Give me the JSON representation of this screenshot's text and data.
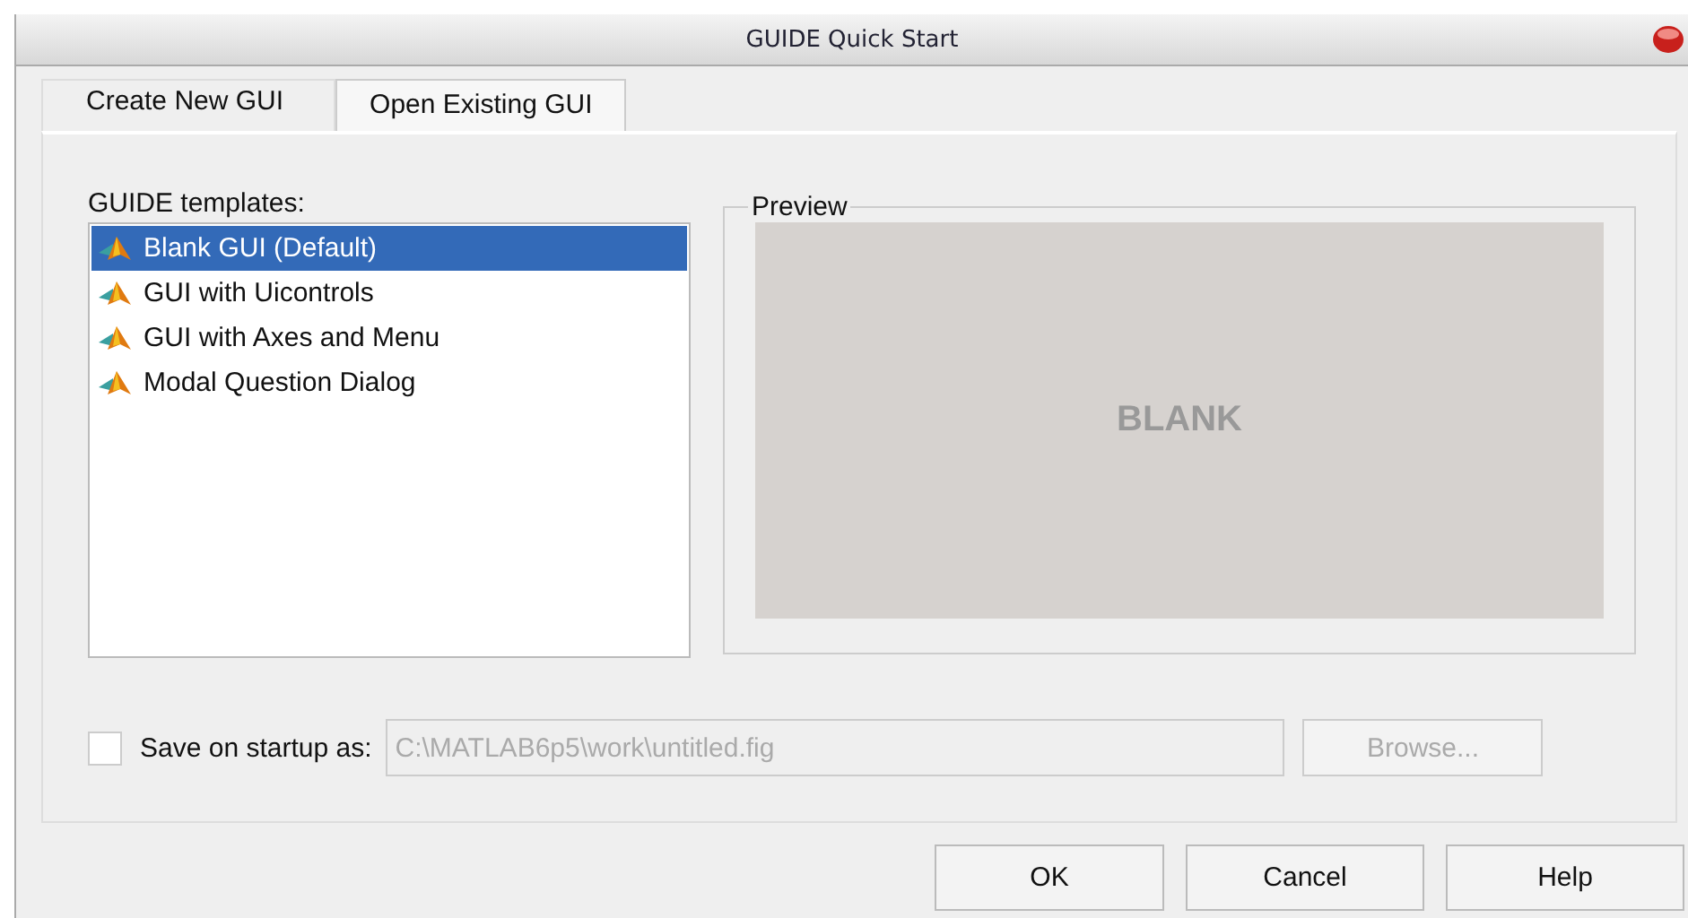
{
  "window": {
    "title": "GUIDE Quick Start"
  },
  "tabs": [
    {
      "label": "Create New GUI",
      "selected": true
    },
    {
      "label": "Open Existing GUI",
      "selected": false
    }
  ],
  "templates": {
    "label": "GUIDE templates:",
    "items": [
      {
        "label": "Blank GUI (Default)",
        "selected": true
      },
      {
        "label": "GUI with Uicontrols",
        "selected": false
      },
      {
        "label": "GUI with Axes and Menu",
        "selected": false
      },
      {
        "label": "Modal Question Dialog",
        "selected": false
      }
    ]
  },
  "preview": {
    "title": "Preview",
    "text": "BLANK"
  },
  "save_on_startup": {
    "label": "Save on startup as:",
    "checked": false,
    "path": "C:\\MATLAB6p5\\work\\untitled.fig",
    "path_disabled": true,
    "browse": {
      "label": "Browse...",
      "disabled": true
    }
  },
  "buttons": [
    "OK",
    "Cancel",
    "Help"
  ]
}
